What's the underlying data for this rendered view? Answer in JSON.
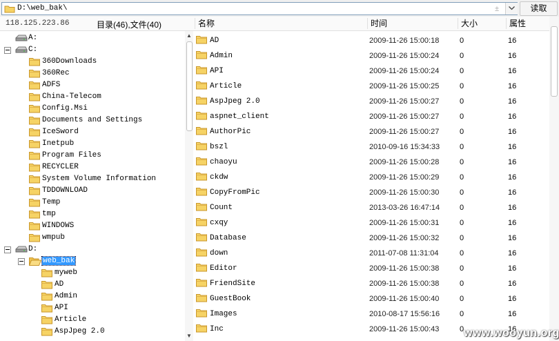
{
  "toolbar": {
    "path": "D:\\web_bak\\",
    "history_symbol": "±",
    "read_label": "读取"
  },
  "header": {
    "ip": "118.125.223.86",
    "counts": "目录(46),文件(40)",
    "col_name": "名称",
    "col_time": "时间",
    "col_size": "大小",
    "col_attr": "属性"
  },
  "tree": [
    {
      "label": "A:",
      "type": "drive",
      "level": 0,
      "expander": false
    },
    {
      "label": "C:",
      "type": "drive",
      "level": 0,
      "expander": true
    },
    {
      "label": "360Downloads",
      "type": "folder",
      "level": 1
    },
    {
      "label": "360Rec",
      "type": "folder",
      "level": 1
    },
    {
      "label": "ADFS",
      "type": "folder",
      "level": 1
    },
    {
      "label": "China-Telecom",
      "type": "folder",
      "level": 1
    },
    {
      "label": "Config.Msi",
      "type": "folder",
      "level": 1
    },
    {
      "label": "Documents and Settings",
      "type": "folder",
      "level": 1
    },
    {
      "label": "IceSword",
      "type": "folder",
      "level": 1
    },
    {
      "label": "Inetpub",
      "type": "folder",
      "level": 1
    },
    {
      "label": "Program Files",
      "type": "folder",
      "level": 1
    },
    {
      "label": "RECYCLER",
      "type": "folder",
      "level": 1
    },
    {
      "label": "System Volume Information",
      "type": "folder",
      "level": 1
    },
    {
      "label": "TDDOWNLOAD",
      "type": "folder",
      "level": 1
    },
    {
      "label": "Temp",
      "type": "folder",
      "level": 1
    },
    {
      "label": "tmp",
      "type": "folder",
      "level": 1
    },
    {
      "label": "WINDOWS",
      "type": "folder",
      "level": 1
    },
    {
      "label": "wmpub",
      "type": "folder",
      "level": 1
    },
    {
      "label": "D:",
      "type": "drive",
      "level": 0,
      "expander": true
    },
    {
      "label": "web_bak",
      "type": "folder-open",
      "level": 1,
      "expander": true,
      "selected": true
    },
    {
      "label": "myweb",
      "type": "folder",
      "level": 2
    },
    {
      "label": "AD",
      "type": "folder",
      "level": 2
    },
    {
      "label": "Admin",
      "type": "folder",
      "level": 2
    },
    {
      "label": "API",
      "type": "folder",
      "level": 2
    },
    {
      "label": "Article",
      "type": "folder",
      "level": 2
    },
    {
      "label": "AspJpeg 2.0",
      "type": "folder",
      "level": 2
    }
  ],
  "files": [
    {
      "name": "AD",
      "time": "2009-11-26 15:00:18",
      "size": "0",
      "attr": "16"
    },
    {
      "name": "Admin",
      "time": "2009-11-26 15:00:24",
      "size": "0",
      "attr": "16"
    },
    {
      "name": "API",
      "time": "2009-11-26 15:00:24",
      "size": "0",
      "attr": "16"
    },
    {
      "name": "Article",
      "time": "2009-11-26 15:00:25",
      "size": "0",
      "attr": "16"
    },
    {
      "name": "AspJpeg 2.0",
      "time": "2009-11-26 15:00:27",
      "size": "0",
      "attr": "16"
    },
    {
      "name": "aspnet_client",
      "time": "2009-11-26 15:00:27",
      "size": "0",
      "attr": "16"
    },
    {
      "name": "AuthorPic",
      "time": "2009-11-26 15:00:27",
      "size": "0",
      "attr": "16"
    },
    {
      "name": "bszl",
      "time": "2010-09-16 15:34:33",
      "size": "0",
      "attr": "16"
    },
    {
      "name": "chaoyu",
      "time": "2009-11-26 15:00:28",
      "size": "0",
      "attr": "16"
    },
    {
      "name": "ckdw",
      "time": "2009-11-26 15:00:29",
      "size": "0",
      "attr": "16"
    },
    {
      "name": "CopyFromPic",
      "time": "2009-11-26 15:00:30",
      "size": "0",
      "attr": "16"
    },
    {
      "name": "Count",
      "time": "2013-03-26 16:47:14",
      "size": "0",
      "attr": "16"
    },
    {
      "name": "cxqy",
      "time": "2009-11-26 15:00:31",
      "size": "0",
      "attr": "16"
    },
    {
      "name": "Database",
      "time": "2009-11-26 15:00:32",
      "size": "0",
      "attr": "16"
    },
    {
      "name": "down",
      "time": "2011-07-08 11:31:04",
      "size": "0",
      "attr": "16"
    },
    {
      "name": "Editor",
      "time": "2009-11-26 15:00:38",
      "size": "0",
      "attr": "16"
    },
    {
      "name": "FriendSite",
      "time": "2009-11-26 15:00:38",
      "size": "0",
      "attr": "16"
    },
    {
      "name": "GuestBook",
      "time": "2009-11-26 15:00:40",
      "size": "0",
      "attr": "16"
    },
    {
      "name": "Images",
      "time": "2010-08-17 15:56:16",
      "size": "0",
      "attr": "16"
    },
    {
      "name": "Inc",
      "time": "2009-11-26 15:00:43",
      "size": "0",
      "attr": "16"
    }
  ],
  "watermark": "www.wooyun.org",
  "colors": {
    "folder": "#f6d365",
    "folder_edge": "#c8962a",
    "selection": "#3399ff"
  }
}
